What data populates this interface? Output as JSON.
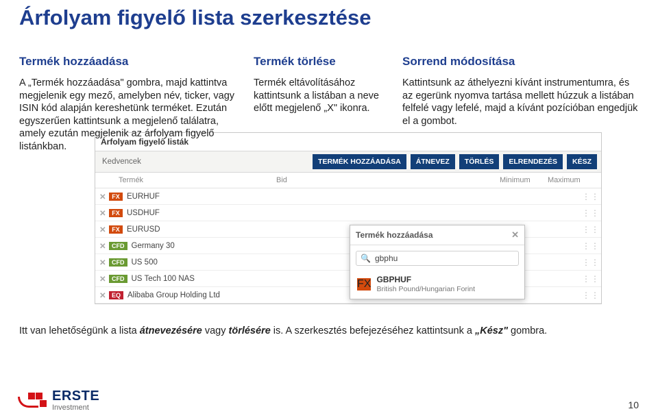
{
  "title": "Árfolyam figyelő lista szerkesztése",
  "columns": {
    "add": {
      "heading": "Termék hozzáadása",
      "body": "A „Termék hozzáadása\" gombra, majd kattintva megjelenik egy mező, amelyben név, ticker, vagy ISIN kód alapján kereshetünk terméket. Ezután egyszerűen kattintsunk a megjelenő találatra, amely ezután megjelenik az árfolyam figyelő listánkban."
    },
    "del": {
      "heading": "Termék törlése",
      "body": "Termék eltávolításához kattintsunk a listában a neve előtt megjelenő „X\" ikonra."
    },
    "order": {
      "heading": "Sorrend módosítása",
      "body": "Kattintsunk az áthelyezni kívánt instrumentumra, és az egerünk nyomva tartása mellett húzzuk a listában felfelé vagy lefelé, majd a kívánt pozícióban engedjük el a gombot."
    }
  },
  "shot": {
    "title": "Árfolyam figyelő listák",
    "fav": "Kedvencek",
    "buttons": [
      "TERMÉK HOZZÁADÁSA",
      "ÁTNEVEZ",
      "TÖRLÉS",
      "ELRENDEZÉS",
      "KÉSZ"
    ],
    "headers": {
      "product": "Termék",
      "bid": "Bid",
      "min": "Minimum",
      "max": "Maximum"
    },
    "rows": [
      {
        "tagClass": "t-fx",
        "tag": "FX",
        "name": "EURHUF"
      },
      {
        "tagClass": "t-fx",
        "tag": "FX",
        "name": "USDHUF"
      },
      {
        "tagClass": "t-fx",
        "tag": "FX",
        "name": "EURUSD"
      },
      {
        "tagClass": "t-cfd",
        "tag": "CFD",
        "name": "Germany 30"
      },
      {
        "tagClass": "t-cfd",
        "tag": "CFD",
        "name": "US 500"
      },
      {
        "tagClass": "t-cfd",
        "tag": "CFD",
        "name": "US Tech 100 NAS"
      },
      {
        "tagClass": "t-eq",
        "tag": "EQ",
        "name": "Alibaba Group Holding Ltd"
      }
    ]
  },
  "popup": {
    "title": "Termék hozzáadása",
    "query": "gbphu",
    "result": {
      "tag": "FX",
      "sym": "GBPHUF",
      "desc": "British Pound/Hungarian Forint"
    }
  },
  "footnote": {
    "p1": "Itt van lehetőségünk a lista ",
    "i1": "átnevezésére",
    "p2": " vagy ",
    "i2": "törlésére",
    "p3": " is. A szerkesztés befejezéséhez kattintsunk a ",
    "i3": "„Kész\"",
    "p4": " gombra."
  },
  "logo": {
    "brand": "ERSTE",
    "sub": "Investment"
  },
  "page": "10"
}
